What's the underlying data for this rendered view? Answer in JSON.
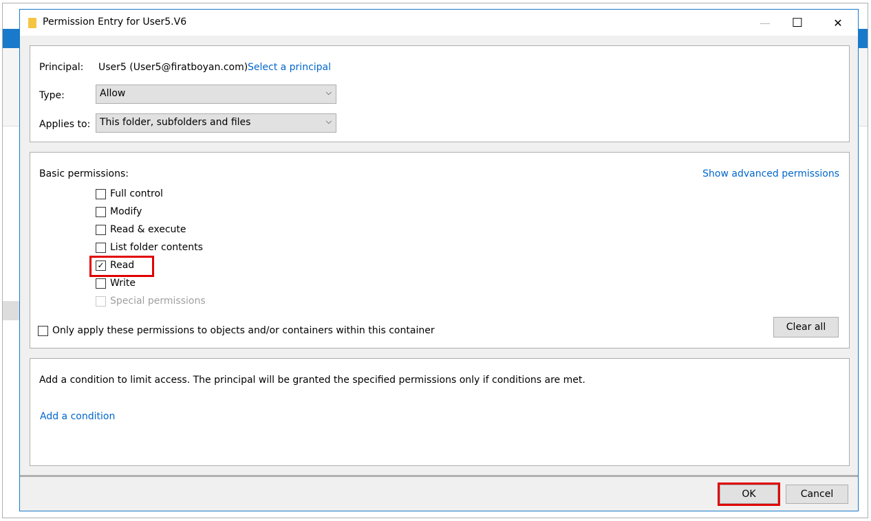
{
  "dialog": {
    "title": "Permission Entry for User5.V6",
    "minimize": "—",
    "maximize": "☐",
    "close": "✕"
  },
  "principal": {
    "label": "Principal:",
    "value": "User5 (User5@firatboyan.com)",
    "link": "Select a principal"
  },
  "type": {
    "label": "Type:",
    "value": "Allow"
  },
  "applies_to": {
    "label": "Applies to:",
    "value": "This folder, subfolders and files"
  },
  "permissions": {
    "label": "Basic permissions:",
    "advanced_link": "Show advanced permissions",
    "items": [
      {
        "label": "Full control",
        "checked": false,
        "enabled": true
      },
      {
        "label": "Modify",
        "checked": false,
        "enabled": true
      },
      {
        "label": "Read & execute",
        "checked": false,
        "enabled": true
      },
      {
        "label": "List folder contents",
        "checked": false,
        "enabled": true
      },
      {
        "label": "Read",
        "checked": true,
        "enabled": true
      },
      {
        "label": "Write",
        "checked": false,
        "enabled": true
      },
      {
        "label": "Special permissions",
        "checked": false,
        "enabled": false
      }
    ],
    "only_apply": "Only apply these permissions to objects and/or containers within this container",
    "clear_all": "Clear all"
  },
  "condition": {
    "text": "Add a condition to limit access. The principal will be granted the specified permissions only if conditions are met.",
    "link": "Add a condition"
  },
  "buttons": {
    "ok": "OK",
    "cancel": "Cancel"
  },
  "colors": {
    "accent": "#1979ca",
    "link": "#0066cc",
    "highlight": "#e00000"
  }
}
